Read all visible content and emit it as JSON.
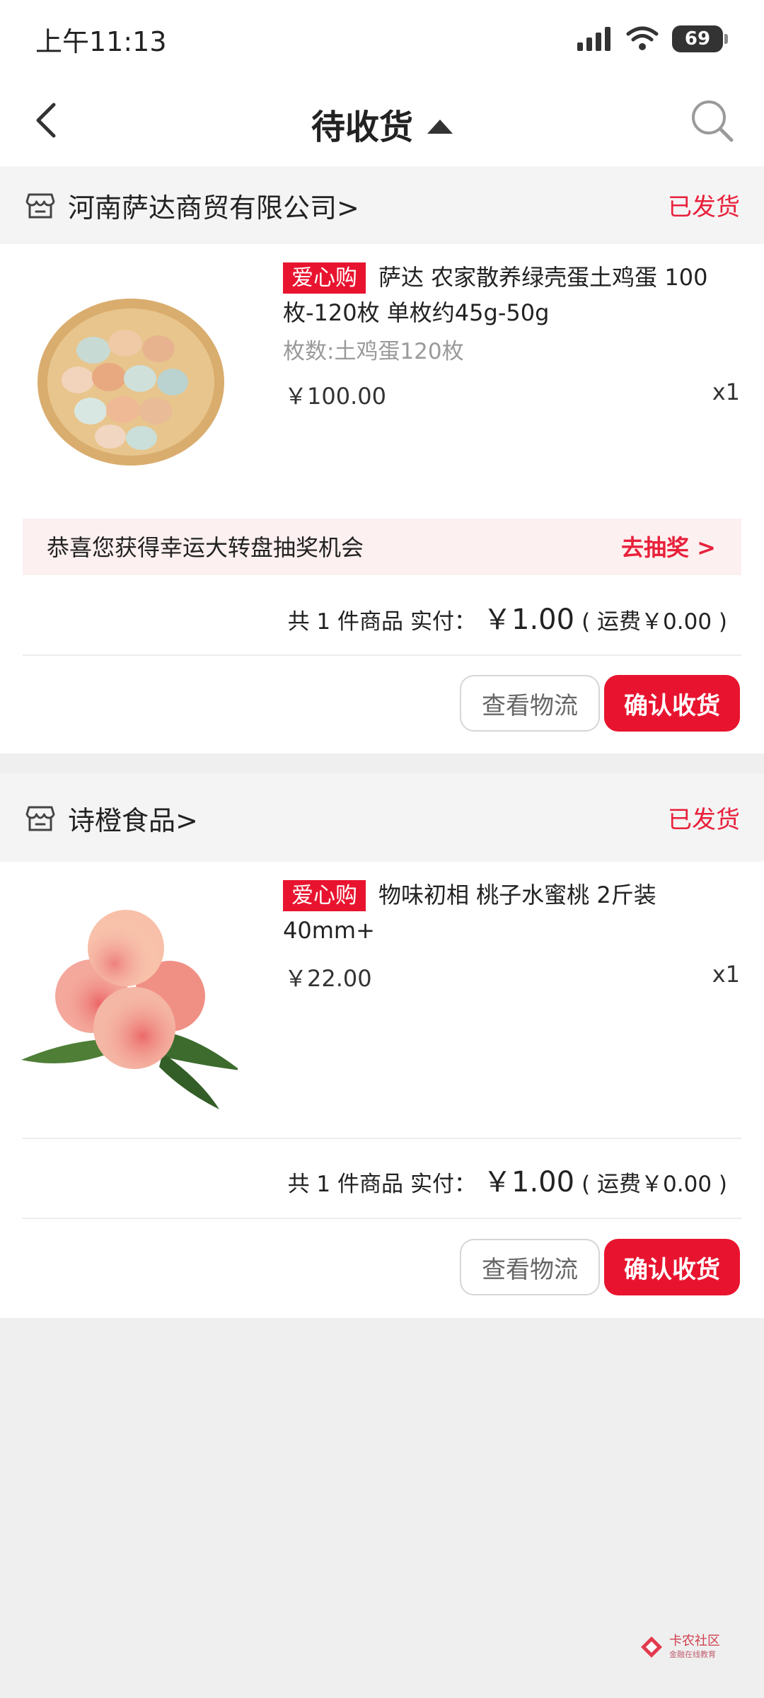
{
  "status_bar": {
    "time": "上午11:13",
    "battery": "69"
  },
  "nav": {
    "title": "待收货"
  },
  "orders": [
    {
      "store": "河南萨达商贸有限公司>",
      "status": "已发货",
      "tag": "爱心购",
      "title": "萨达 农家散养绿壳蛋土鸡蛋 100枚-120枚 单枚约45g-50g",
      "spec": "枚数:土鸡蛋120枚",
      "price": "￥100.00",
      "qty": "x1",
      "lottery_text": "恭喜您获得幸运大转盘抽奖机会",
      "lottery_link": "去抽奖 >",
      "summary_count": "共 1 件商品",
      "summary_paid_label": "实付：",
      "summary_paid": "￥1.00",
      "summary_shipping": "( 运费￥0.00 )",
      "btn_logistics": "查看物流",
      "btn_confirm": "确认收货"
    },
    {
      "store": "诗橙食品>",
      "status": "已发货",
      "tag": "爱心购",
      "title": "物味初相 桃子水蜜桃 2斤装 40mm+",
      "price": "￥22.00",
      "qty": "x1",
      "summary_count": "共 1 件商品",
      "summary_paid_label": "实付：",
      "summary_paid": "￥1.00",
      "summary_shipping": "( 运费￥0.00 )",
      "btn_logistics": "查看物流",
      "btn_confirm": "确认收货"
    }
  ],
  "watermark": {
    "text": "卡农社区",
    "sub": "金融在线教育"
  },
  "colors": {
    "accent": "#e8142f",
    "status_red": "#e8213b",
    "page_bg": "#efefef"
  }
}
